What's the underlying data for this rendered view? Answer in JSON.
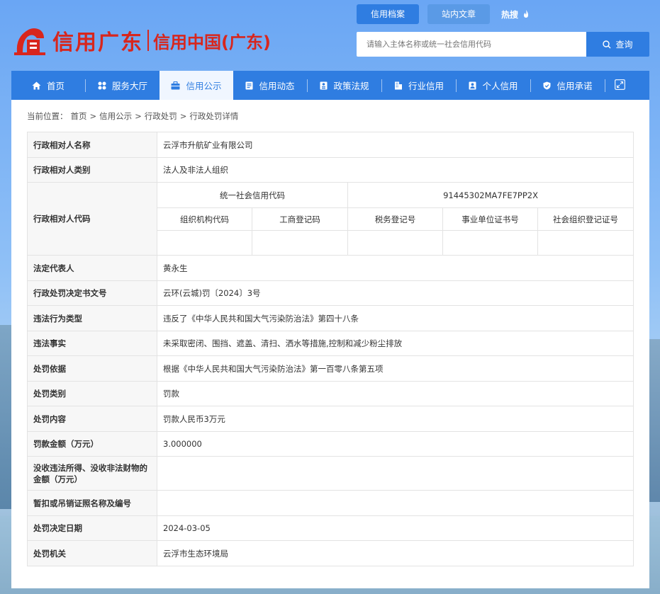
{
  "colors": {
    "primary": "#2f7de1",
    "logo_red": "#d8261d"
  },
  "header": {
    "logo_text": "信用广东",
    "logo_subtitle": "信用中国(广东)",
    "top_tabs": [
      {
        "label": "信用档案",
        "active": true
      },
      {
        "label": "站内文章",
        "active": false
      }
    ],
    "hot_label": "热搜",
    "search": {
      "placeholder": "请输入主体名称或统一社会信用代码",
      "button_label": "查询"
    }
  },
  "nav": {
    "items": [
      {
        "label": "首页",
        "icon": "home-icon"
      },
      {
        "label": "服务大厅",
        "icon": "grid-icon"
      },
      {
        "label": "信用公示",
        "icon": "briefcase-icon",
        "active": true
      },
      {
        "label": "信用动态",
        "icon": "document-icon"
      },
      {
        "label": "政策法规",
        "icon": "rules-icon"
      },
      {
        "label": "行业信用",
        "icon": "building-icon"
      },
      {
        "label": "个人信用",
        "icon": "person-icon"
      },
      {
        "label": "信用承诺",
        "icon": "shield-icon"
      }
    ]
  },
  "breadcrumb": {
    "prefix": "当前位置：",
    "items": [
      "首页",
      "信用公示",
      "行政处罚",
      "行政处罚详情"
    ],
    "separator": ">"
  },
  "detail": {
    "party_name": {
      "label": "行政相对人名称",
      "value": "云浮市升航矿业有限公司"
    },
    "party_type": {
      "label": "行政相对人类别",
      "value": "法人及非法人组织"
    },
    "party_code": {
      "label": "行政相对人代码",
      "uscc_label": "统一社会信用代码",
      "uscc_value": "91445302MA7FE7PP2X",
      "sub_headers": [
        "组织机构代码",
        "工商登记码",
        "税务登记号",
        "事业单位证书号",
        "社会组织登记证号"
      ],
      "sub_values": [
        "",
        "",
        "",
        "",
        ""
      ]
    },
    "legal_rep": {
      "label": "法定代表人",
      "value": "黄永生"
    },
    "decision_no": {
      "label": "行政处罚决定书文号",
      "value": "云环(云城)罚〔2024〕3号"
    },
    "violation_type": {
      "label": "违法行为类型",
      "value": "违反了《中华人民共和国大气污染防治法》第四十八条"
    },
    "violation_facts": {
      "label": "违法事实",
      "value": "未采取密闭、围挡、遮盖、清扫、洒水等措施,控制和减少粉尘排放"
    },
    "basis": {
      "label": "处罚依据",
      "value": "根据《中华人民共和国大气污染防治法》第一百零八条第五项"
    },
    "category": {
      "label": "处罚类别",
      "value": "罚款"
    },
    "content": {
      "label": "处罚内容",
      "value": "罚款人民币3万元"
    },
    "fine": {
      "label": "罚款金额（万元）",
      "value": "3.000000"
    },
    "confiscation": {
      "label": "没收违法所得、没收非法财物的金额（万元）",
      "value": ""
    },
    "license": {
      "label": "暂扣或吊销证照名称及编号",
      "value": ""
    },
    "decision_date": {
      "label": "处罚决定日期",
      "value": "2024-03-05"
    },
    "authority": {
      "label": "处罚机关",
      "value": "云浮市生态环境局"
    }
  }
}
